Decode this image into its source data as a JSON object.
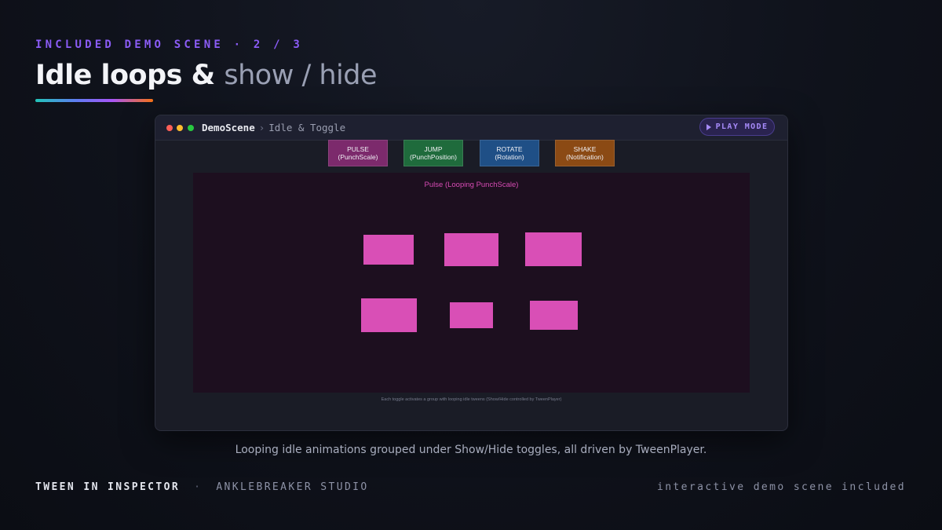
{
  "slide": {
    "eyebrow": "INCLUDED DEMO SCENE · 2 / 3",
    "title_bold": "Idle loops &",
    "title_light": "show / hide",
    "caption": "Looping idle animations grouped under Show/Hide toggles, all driven by TweenPlayer."
  },
  "window": {
    "scene_name": "DemoScene",
    "separator": "›",
    "sub_scene": "Idle & Toggle",
    "play_mode_label": "PLAY MODE",
    "toggles": [
      {
        "line1": "PULSE",
        "line2": "(PunchScale)",
        "color": "#7c2a6c"
      },
      {
        "line1": "JUMP",
        "line2": "(PunchPosition)",
        "color": "#1f6b3c"
      },
      {
        "line1": "ROTATE",
        "line2": "(Rotation)",
        "color": "#1f4f86"
      },
      {
        "line1": "SHAKE",
        "line2": "(Notification)",
        "color": "#8b4a14"
      }
    ],
    "panel_title": "Pulse (Looping PunchScale)",
    "tile_color": "#d94fb6",
    "footer_note": "Each toggle activates a group with looping idle tweens (Show/Hide controlled by TweenPlayer)"
  },
  "footer": {
    "brand": "TWEEN IN INSPECTOR",
    "separator": "·",
    "studio": "ANKLEBREAKER STUDIO",
    "right_text": "interactive demo scene included"
  },
  "colors": {
    "accent_purple": "#8b5cf6",
    "background": "#0f121b"
  }
}
